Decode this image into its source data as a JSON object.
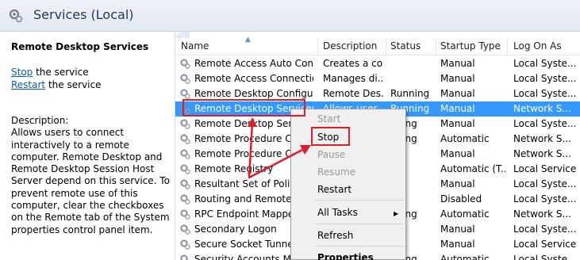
{
  "window": {
    "title": "Services (Local)",
    "icon": "services-gear-icon"
  },
  "left_pane": {
    "service_name": "Remote Desktop Services",
    "stop_link": "Stop",
    "stop_suffix": " the service",
    "restart_link": "Restart",
    "restart_suffix": " the service",
    "description_label": "Description:",
    "description_text": "Allows users to connect interactively to a remote computer. Remote Desktop and Remote Desktop Session Host Server depend on this service. To prevent remote use of this computer, clear the checkboxes on the Remote tab of the System properties control panel item."
  },
  "table": {
    "headers": [
      "Name",
      "Description",
      "Status",
      "Startup Type",
      "Log On As"
    ],
    "rows": [
      [
        "Remote Access Auto Conne...",
        "Creates a co...",
        "",
        "Manual",
        "Local Syste..."
      ],
      [
        "Remote Access Connection...",
        "Manages di...",
        "",
        "Manual",
        "Local Syste..."
      ],
      [
        "Remote Desktop Configurat...",
        "Remote Des...",
        "Running",
        "Manual",
        "Local Syste..."
      ],
      [
        "Remote Desktop Services",
        "Allows user...",
        "Running",
        "Manual",
        "Network S..."
      ],
      [
        "Remote Desktop Servic",
        "",
        "nning",
        "Manual",
        "Local Syste..."
      ],
      [
        "Remote Procedure Call",
        "",
        "nning",
        "Automatic",
        "Network S..."
      ],
      [
        "Remote Procedure Call",
        "",
        "",
        "Manual",
        "Network S..."
      ],
      [
        "Remote Registry",
        "",
        "",
        "Automatic (T...",
        "Local Service"
      ],
      [
        "Resultant Set of Policy I",
        "",
        "",
        "Manual",
        "Local Syste..."
      ],
      [
        "Routing and Remote Ac",
        "",
        "",
        "Disabled",
        "Local Syste..."
      ],
      [
        "RPC Endpoint Mapper",
        "",
        "nning",
        "Automatic",
        "Network S..."
      ],
      [
        "Secondary Logon",
        "",
        "",
        "Manual",
        "Local Syste..."
      ],
      [
        "Secure Socket Tunnelin",
        "",
        "",
        "Manual",
        "Local Service"
      ],
      [
        "Security Accounts Man",
        "",
        "nning",
        "Automatic",
        "Local Syste..."
      ]
    ],
    "selected_row": 3
  },
  "context_menu": {
    "start": "Start",
    "stop": "Stop",
    "pause": "Pause",
    "resume": "Resume",
    "restart": "Restart",
    "all_tasks": "All Tasks",
    "all_tasks_arrow": "▶",
    "refresh": "Refresh",
    "properties": "Properties"
  },
  "colors": {
    "selection": "#3399ff",
    "annotation": "#e01e2a",
    "link": "#0b5bb0"
  }
}
